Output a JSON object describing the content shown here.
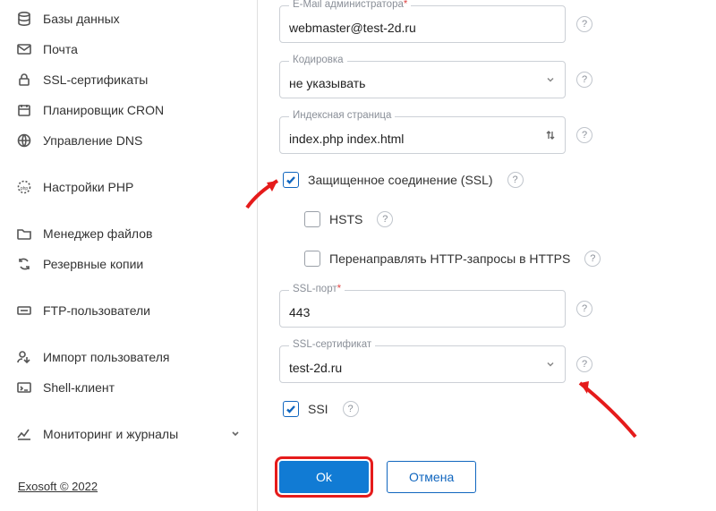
{
  "sidebar": {
    "items": [
      {
        "label": "Базы данных",
        "icon": "database"
      },
      {
        "label": "Почта",
        "icon": "mail"
      },
      {
        "label": "SSL-сертификаты",
        "icon": "lock"
      },
      {
        "label": "Планировщик CRON",
        "icon": "calendar"
      },
      {
        "label": "Управление DNS",
        "icon": "globe"
      }
    ],
    "group2": [
      {
        "label": "Настройки PHP",
        "icon": "php"
      }
    ],
    "group3": [
      {
        "label": "Менеджер файлов",
        "icon": "folder"
      },
      {
        "label": "Резервные копии",
        "icon": "refresh"
      }
    ],
    "group4": [
      {
        "label": "FTP-пользователи",
        "icon": "ftp"
      }
    ],
    "group5": [
      {
        "label": "Импорт пользователя",
        "icon": "import"
      },
      {
        "label": "Shell-клиент",
        "icon": "shell"
      }
    ],
    "group6": [
      {
        "label": "Мониторинг и журналы",
        "icon": "monitor",
        "expandable": true
      }
    ]
  },
  "footer": {
    "copyright": "Exosoft © 2022"
  },
  "form": {
    "email_label": "E-Mail администратора",
    "email_value": "webmaster@test-2d.ru",
    "encoding_label": "Кодировка",
    "encoding_value": "не указывать",
    "index_label": "Индексная страница",
    "index_value": "index.php index.html",
    "ssl_label": "Защищенное соединение (SSL)",
    "hsts_label": "HSTS",
    "redirect_label": "Перенаправлять HTTP-запросы в HTTPS",
    "ssl_port_label": "SSL-порт",
    "ssl_port_value": "443",
    "ssl_cert_label": "SSL-сертификат",
    "ssl_cert_value": "test-2d.ru",
    "ssi_label": "SSI"
  },
  "buttons": {
    "ok": "Ok",
    "cancel": "Отмена"
  }
}
